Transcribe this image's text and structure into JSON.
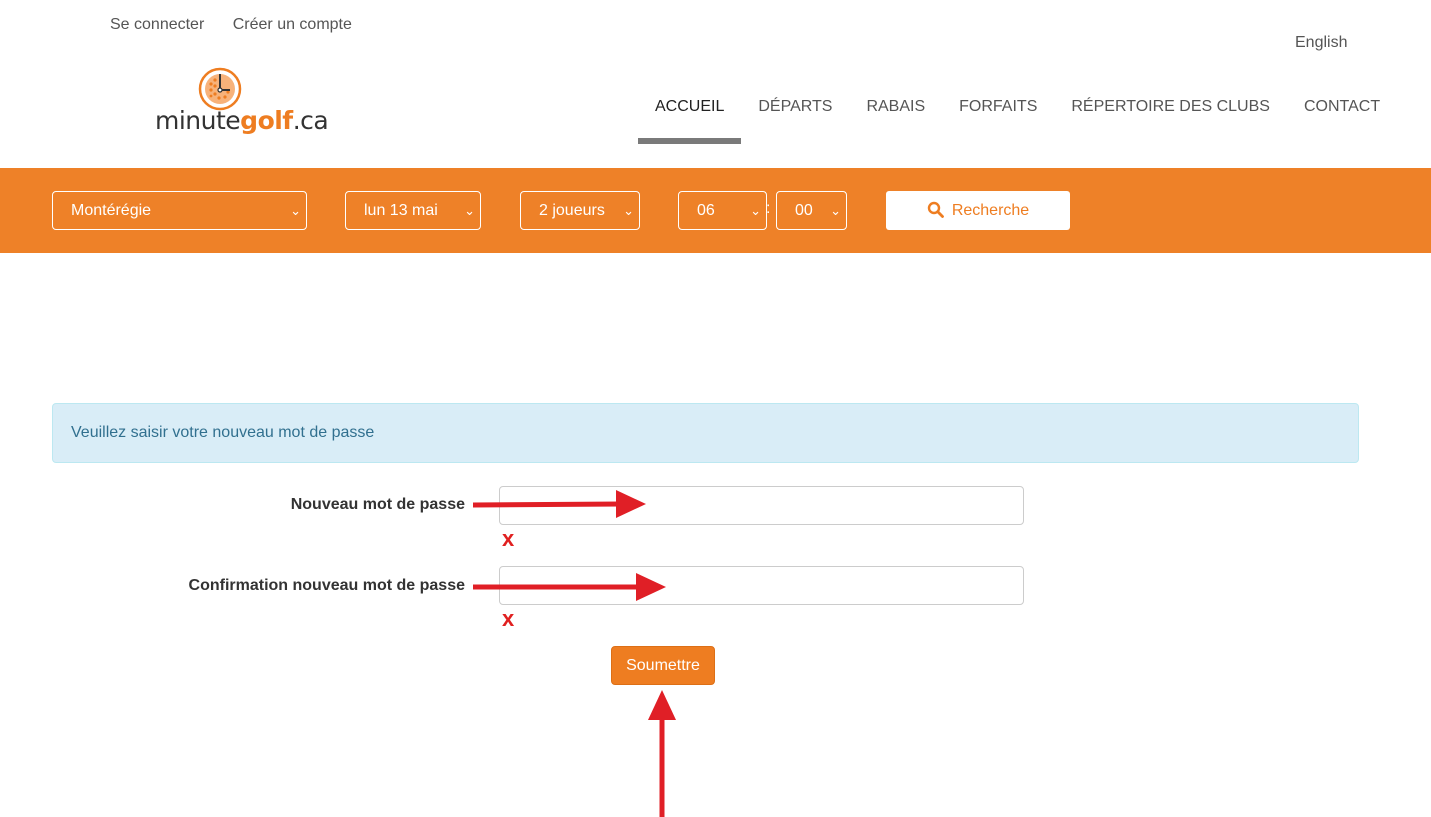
{
  "topbar": {
    "login": "Se connecter",
    "register": "Créer un compte"
  },
  "language": "English",
  "logo": {
    "text_before": "minute",
    "text_brand": "golf",
    "text_after": ".ca",
    "brand_color": "#ee7d21"
  },
  "nav": [
    {
      "label": "ACCUEIL",
      "active": true
    },
    {
      "label": "DÉPARTS"
    },
    {
      "label": "RABAIS"
    },
    {
      "label": "FORFAITS"
    },
    {
      "label": "RÉPERTOIRE DES CLUBS"
    },
    {
      "label": "CONTACT"
    }
  ],
  "search": {
    "region": "Montérégie",
    "date": "lun 13 mai",
    "players": "2 joueurs",
    "hour": "06",
    "minute": "00",
    "time_separator": ":",
    "button": "Recherche",
    "bar_color": "#ee8128"
  },
  "alert": {
    "message": "Veuillez saisir votre nouveau mot de passe"
  },
  "form": {
    "new_password_label": "Nouveau mot de passe",
    "confirm_password_label": "Confirmation nouveau mot de passe",
    "new_password_value": "",
    "confirm_password_value": "",
    "error_mark": "x",
    "submit": "Soumettre"
  },
  "annotation": {
    "arrow_color": "#e01f26"
  }
}
